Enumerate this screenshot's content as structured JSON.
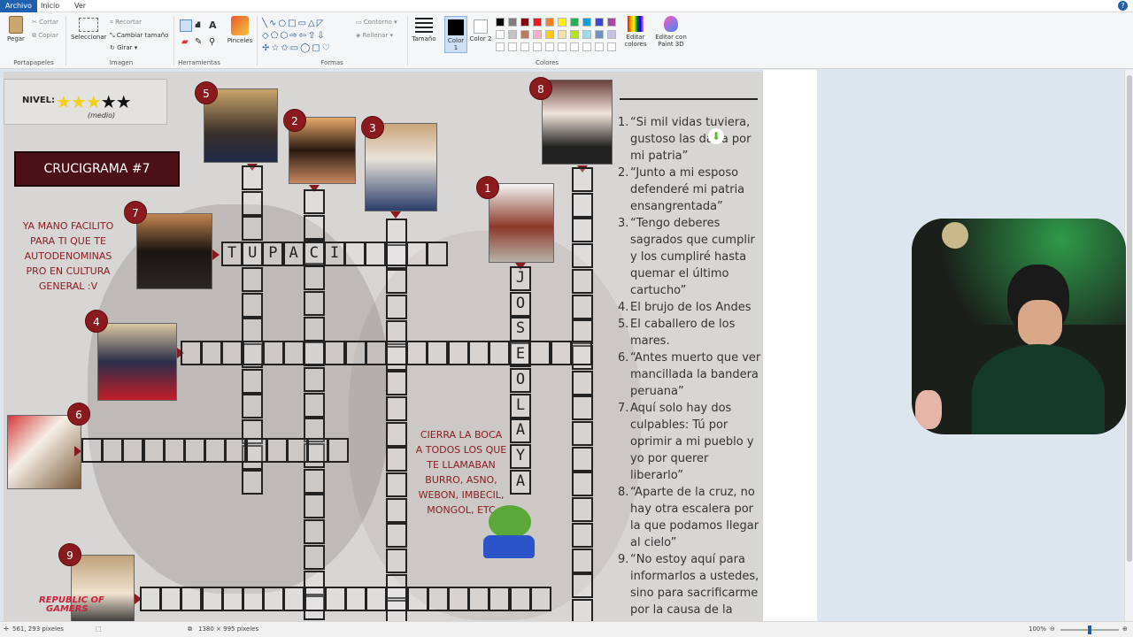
{
  "menubar": {
    "tabs": [
      "Archivo",
      "Inicio",
      "Ver"
    ]
  },
  "ribbon": {
    "clipboard": {
      "paste": "Pegar",
      "cut": "Cortar",
      "copy": "Copiar",
      "group": "Portapapeles"
    },
    "image": {
      "select": "Seleccionar",
      "crop": "Recortar",
      "resize": "Cambiar tamaño",
      "rotate": "Girar",
      "group": "Imagen"
    },
    "tools": {
      "group": "Herramientas"
    },
    "brushes": {
      "label": "Pinceles"
    },
    "shapes": {
      "outline": "Contorno",
      "fill": "Rellenar",
      "group": "Formas"
    },
    "size": {
      "label": "Tamaño"
    },
    "color1": {
      "label": "Color 1"
    },
    "color2": {
      "label": "Color 2"
    },
    "colors": {
      "group": "Colores",
      "edit": "Editar colores",
      "paint3d": "Editar con Paint 3D",
      "palette_row1": [
        "#000000",
        "#7f7f7f",
        "#880015",
        "#ed1c24",
        "#ff7f27",
        "#fff200",
        "#22b14c",
        "#00a2e8",
        "#3f48cc",
        "#a349a4"
      ],
      "palette_row2": [
        "#ffffff",
        "#c3c3c3",
        "#b97a57",
        "#ffaec9",
        "#ffc90e",
        "#efe4b0",
        "#b5e61d",
        "#99d9ea",
        "#7092be",
        "#c8bfe7"
      ]
    }
  },
  "worksheet": {
    "nivel_label": "NIVEL:",
    "stars_filled": 3,
    "stars_total": 5,
    "nivel_caption": "(medio)",
    "title": "CRUCIGRAMA #7",
    "note_left": [
      "YA MANO FACILITO",
      "PARA TI QUE TE",
      "AUTODENOMINAS",
      "PRO EN  CULTURA",
      "GENERAL :V"
    ],
    "note_center": [
      "CIERRA LA BOCA",
      "A TODOS LOS QUE",
      "TE LLAMABAN",
      "BURRO, ASNO,",
      "WEBON, IMBECIL,",
      "MONGOL, ETC"
    ],
    "badges": [
      "1",
      "2",
      "3",
      "4",
      "5",
      "6",
      "7",
      "8",
      "9"
    ],
    "word7": [
      "T",
      "U",
      "P",
      "A",
      "C",
      "I"
    ],
    "word1": [
      "J",
      "O",
      "S",
      "E",
      "O",
      "L",
      "A",
      "Y",
      "A"
    ],
    "clues": [
      {
        "num": "1.",
        "text": "“Si mil vidas tuviera, gustoso las daría por mi patria”"
      },
      {
        "num": "2.",
        "text": "“Junto a mi esposo defenderé mi patria ensangrentada”"
      },
      {
        "num": "3.",
        "text": "“Tengo deberes sagrados que cumplir y los cumpliré hasta quemar el último cartucho”"
      },
      {
        "num": "4.",
        "text": "El brujo de los Andes"
      },
      {
        "num": "5.",
        "text": "El caballero de los mares."
      },
      {
        "num": "6.",
        "text": "“Antes muerto que ver mancillada la bandera peruana”"
      },
      {
        "num": "7.",
        "text": "Aquí solo hay dos culpables: Tú por oprimir a mi pueblo y yo por querer liberarlo”"
      },
      {
        "num": "8.",
        "text": "“Aparte de la cruz, no hay otra escalera por la que podamos llegar al cielo”"
      },
      {
        "num": "9.",
        "text": "“No estoy aquí para informarlos a ustedes, sino para sacrificarme por la causa de la"
      }
    ]
  },
  "watermark": {
    "line1": "REPUBLIC OF",
    "line2": "GAMERS"
  },
  "statusbar": {
    "cursor": "561, 293 píxeles",
    "dimensions": "1380 × 995 píxeles",
    "zoom": "100%"
  }
}
